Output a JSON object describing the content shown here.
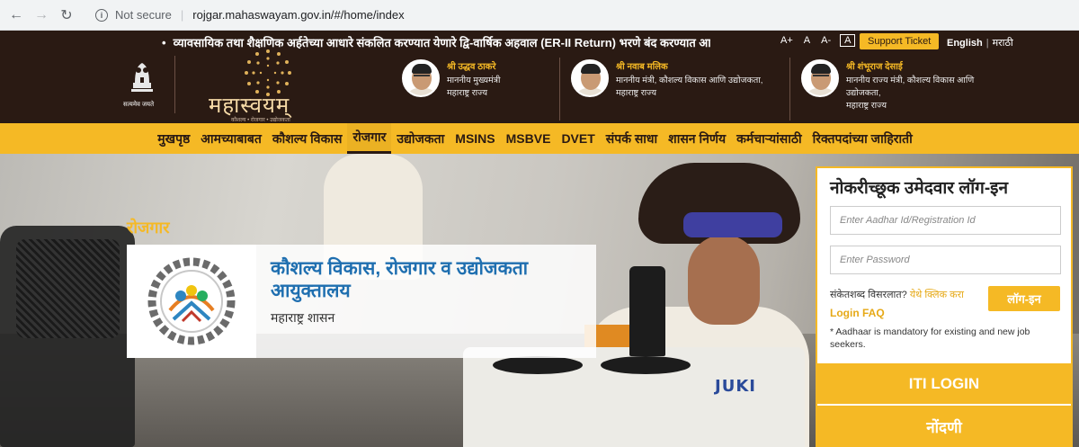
{
  "browser": {
    "not_secure": "Not secure",
    "url": "rojgar.mahaswayam.gov.in/#/home/index"
  },
  "header": {
    "ticker": "व्यावसायिक तथा शैक्षणिक अर्हतेच्या आधारे संकलित करण्यात येणारे द्वि-वार्षिक अहवाल (ER-II Return) भरणे बंद करण्यात आले आं",
    "font_large": "A+",
    "font_normal": "A",
    "font_small": "A-",
    "font_contrast": "A",
    "support_ticket": "Support Ticket",
    "lang_en": "English",
    "lang_mr": "मराठी",
    "emblem_caption": "सत्यमेव जयते",
    "logo_title": "महास्वयम्",
    "logo_sub": "कौशल्य • रोजगार • उद्योजकता"
  },
  "ministers": [
    {
      "name": "श्री उद्धव ठाकरे",
      "role1": "माननीय मुख्यमंत्री",
      "role2": "महाराष्ट्र राज्य",
      "role3": ""
    },
    {
      "name": "श्री नवाब मलिक",
      "role1": "माननीय मंत्री, कौशल्य विकास आणि उद्योजकता,",
      "role2": "महाराष्ट्र राज्य",
      "role3": ""
    },
    {
      "name": "श्री शंभूराज देसाई",
      "role1": "माननीय राज्य मंत्री, कौशल्य विकास आणि",
      "role2": "उद्योजकता,",
      "role3": "महाराष्ट्र राज्य"
    }
  ],
  "nav": [
    "मुखपृष्ठ",
    "आमच्याबाबत",
    "कौशल्य विकास",
    "रोजगार",
    "उद्योजकता",
    "MSINS",
    "MSBVE",
    "DVET",
    "संपर्क साधा",
    "शासन निर्णय",
    "कर्मचाऱ्यांसाठी",
    "रिक्तपदांच्या जाहिराती"
  ],
  "hero": {
    "section_label": "रोजगार",
    "dept_title_1": "कौशल्य विकास, रोजगार व उद्योजकता",
    "dept_title_2": "आयुक्तालय",
    "dept_sub": "महाराष्ट्र शासन",
    "machine_brand": "JUKI"
  },
  "login": {
    "title": "नोकरीच्छूक उमेदवार लॉग-इन",
    "aadhar_placeholder": "Enter Aadhar Id/Registration Id",
    "password_placeholder": "Enter Password",
    "forgot_text": "संकेतशब्द विसरलात?",
    "forgot_link": "येथे क्लिक करा",
    "login_btn": "लॉग-इन",
    "faq": "Login FAQ",
    "note": "* Aadhaar is mandatory for existing and new job seekers.",
    "iti_login": "ITI LOGIN",
    "register": "नोंदणी"
  },
  "colors": {
    "brand_yellow": "#f5b925",
    "header_dark": "#2a1a13",
    "title_blue": "#1f6fb0"
  }
}
